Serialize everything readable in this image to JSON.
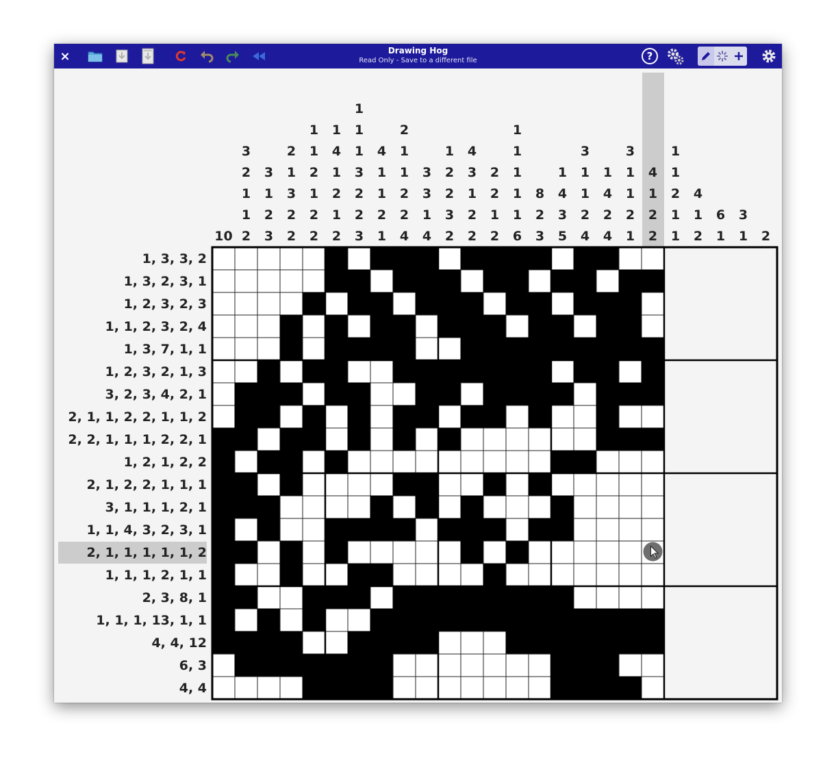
{
  "titlebar": {
    "title": "Drawing Hog",
    "subtitle": "Read Only - Save to a different file",
    "close_label": "×",
    "colors": {
      "bar": "#1e1a9c",
      "folder": "#5aa8dc",
      "refresh": "#e23a2a",
      "undo": "#a08b6a",
      "redo": "#4a8a5a",
      "rewind": "#3a6ad8"
    }
  },
  "icons": [
    "close-icon",
    "folder-icon",
    "save-icon",
    "save-as-icon",
    "refresh-icon",
    "undo-icon",
    "redo-icon",
    "rewind-icon",
    "help-icon",
    "solver-settings-icon",
    "pencil-icon",
    "spinner-icon",
    "plus-icon",
    "gear-icon"
  ],
  "puzzle": {
    "highlighted_column": 19,
    "highlighted_row": 13,
    "column_clues": [
      [
        "10"
      ],
      [
        "3",
        "2",
        "1",
        "1",
        "2"
      ],
      [
        "3",
        "1",
        "2",
        "3"
      ],
      [
        "2",
        "1",
        "3",
        "2",
        "2"
      ],
      [
        "1",
        "1",
        "2",
        "1",
        "2",
        "2"
      ],
      [
        "1",
        "4",
        "1",
        "2",
        "1",
        "2"
      ],
      [
        "1",
        "1",
        "1",
        "3",
        "2",
        "2",
        "3"
      ],
      [
        "4",
        "1",
        "1",
        "2",
        "1"
      ],
      [
        "2",
        "1",
        "1",
        "2",
        "2",
        "4"
      ],
      [
        "3",
        "3",
        "1",
        "4"
      ],
      [
        "1",
        "2",
        "2",
        "3",
        "2"
      ],
      [
        "4",
        "3",
        "1",
        "2",
        "2"
      ],
      [
        "2",
        "2",
        "1",
        "2"
      ],
      [
        "1",
        "1",
        "1",
        "1",
        "1",
        "6"
      ],
      [
        "8",
        "2",
        "3"
      ],
      [
        "1",
        "4",
        "3",
        "5"
      ],
      [
        "3",
        "1",
        "1",
        "2",
        "4"
      ],
      [
        "1",
        "4",
        "2",
        "4"
      ],
      [
        "3",
        "1",
        "1",
        "2",
        "1"
      ],
      [
        "4",
        "1",
        "2",
        "2"
      ],
      [
        "1",
        "1",
        "2",
        "1",
        "1"
      ],
      [
        "4",
        "1",
        "2"
      ],
      [
        "6",
        "1"
      ],
      [
        "3",
        "1"
      ],
      [
        "2"
      ]
    ],
    "row_clues": [
      "1, 3, 3, 2",
      "1, 3, 2, 3, 1",
      "1, 2, 3, 2, 3",
      "1, 1, 2, 3, 2, 4",
      "1, 3, 7, 1, 1",
      "1, 2, 3, 2, 1, 3",
      "3, 2, 3, 4, 2, 1",
      "2, 1, 1, 2, 2, 1, 1, 2",
      "2, 2, 1, 1, 1, 2, 2, 1",
      "1, 2, 1, 2, 2",
      "2, 1, 2, 2, 1, 1, 1",
      "3, 1, 1, 1, 2, 1",
      "1, 1, 4, 3, 2, 3, 1",
      "2, 1, 1, 1, 1, 1, 2",
      "1, 1, 1, 2, 1, 1",
      "2, 3, 8, 1",
      "1, 1, 1, 13, 1, 1",
      "4, 4, 12",
      "6, 3",
      "4, 4"
    ],
    "grid": [
      "00000101110111101100",
      "00000110111011011011",
      "00001011011101101110",
      "00010101101110110110",
      "00010111100111111111",
      "00101100111111101101",
      "01110110011011110111",
      "01101010110110100100",
      "11011010101000000111",
      "10110100000000011000",
      "11010000110010100000",
      "11100001010100010000",
      "10100111101110110000",
      "11010100000101000000",
      "10010011000010000000",
      "11001110111111110000",
      "10101001111111111111",
      "11110011110001111111",
      "01111111000000011100",
      "00001111000000011110"
    ]
  }
}
